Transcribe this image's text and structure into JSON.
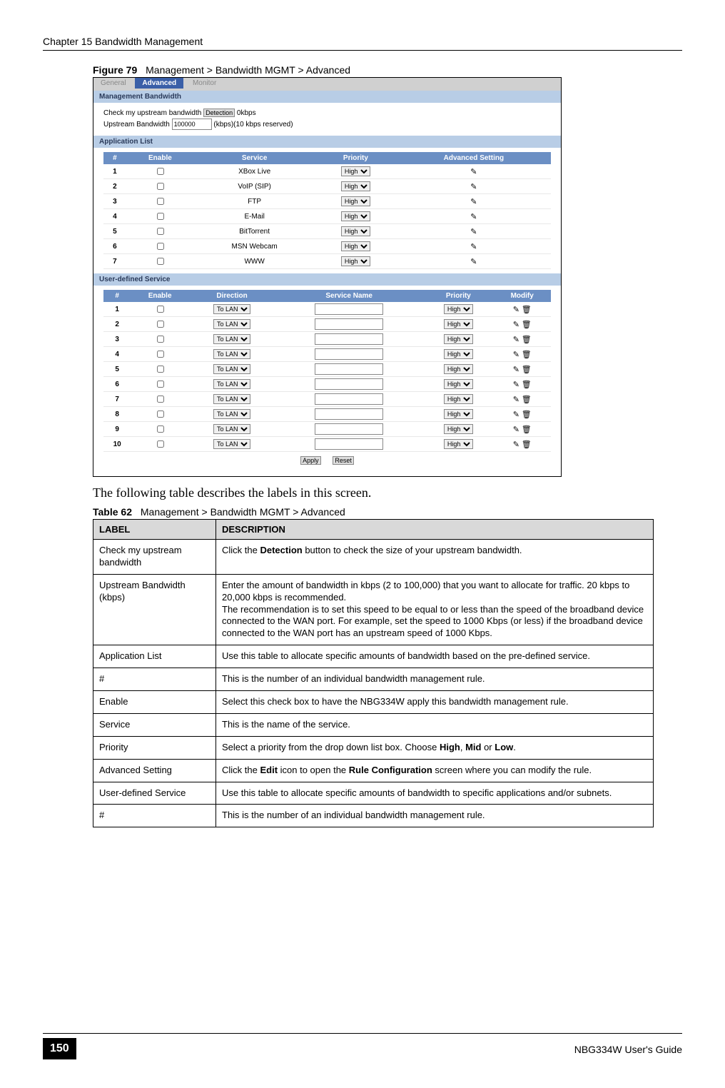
{
  "header": {
    "chapter": "Chapter 15 Bandwidth Management"
  },
  "figure": {
    "label": "Figure 79",
    "title": "Management > Bandwidth MGMT > Advanced"
  },
  "screenshot": {
    "tabs": [
      "General",
      "Advanced",
      "Monitor"
    ],
    "active_tab": "Advanced",
    "mgmt_bw_header": "Management Bandwidth",
    "check_label": "Check my upstream bandwidth",
    "detection_btn": "Detection",
    "check_suffix": "0kbps",
    "upstream_label": "Upstream Bandwidth",
    "upstream_value": "100000",
    "upstream_suffix": "(kbps)(10 kbps reserved)",
    "app_list_header": "Application List",
    "app_cols": [
      "#",
      "Enable",
      "Service",
      "Priority",
      "Advanced Setting"
    ],
    "app_rows": [
      {
        "n": "1",
        "svc": "XBox Live",
        "pri": "High"
      },
      {
        "n": "2",
        "svc": "VoIP (SIP)",
        "pri": "High"
      },
      {
        "n": "3",
        "svc": "FTP",
        "pri": "High"
      },
      {
        "n": "4",
        "svc": "E-Mail",
        "pri": "High"
      },
      {
        "n": "5",
        "svc": "BitTorrent",
        "pri": "High"
      },
      {
        "n": "6",
        "svc": "MSN Webcam",
        "pri": "High"
      },
      {
        "n": "7",
        "svc": "WWW",
        "pri": "High"
      }
    ],
    "uds_header": "User-defined Service",
    "uds_cols": [
      "#",
      "Enable",
      "Direction",
      "Service Name",
      "Priority",
      "Modify"
    ],
    "uds_rows": [
      {
        "n": "1",
        "dir": "To LAN",
        "pri": "High"
      },
      {
        "n": "2",
        "dir": "To LAN",
        "pri": "High"
      },
      {
        "n": "3",
        "dir": "To LAN",
        "pri": "High"
      },
      {
        "n": "4",
        "dir": "To LAN",
        "pri": "High"
      },
      {
        "n": "5",
        "dir": "To LAN",
        "pri": "High"
      },
      {
        "n": "6",
        "dir": "To LAN",
        "pri": "High"
      },
      {
        "n": "7",
        "dir": "To LAN",
        "pri": "High"
      },
      {
        "n": "8",
        "dir": "To LAN",
        "pri": "High"
      },
      {
        "n": "9",
        "dir": "To LAN",
        "pri": "High"
      },
      {
        "n": "10",
        "dir": "To LAN",
        "pri": "High"
      }
    ],
    "apply_btn": "Apply",
    "reset_btn": "Reset"
  },
  "intro_text": "The following table describes the labels in this screen.",
  "table": {
    "label": "Table 62",
    "title": "Management > Bandwidth MGMT > Advanced",
    "col_label": "LABEL",
    "col_desc": "DESCRIPTION",
    "rows": [
      {
        "label": "Check my upstream bandwidth",
        "desc": "Click the <b>Detection</b> button to check the size of your upstream bandwidth."
      },
      {
        "label": "Upstream Bandwidth (kbps)",
        "desc": "Enter the amount of bandwidth in kbps (2 to 100,000) that you want to allocate for traffic. 20 kbps to 20,000 kbps is recommended.<br>The recommendation is to set this speed to be equal to or less than the speed of the broadband device connected to the WAN port. For example, set the speed to 1000 Kbps (or less) if the broadband device connected to the WAN port has an upstream speed of 1000 Kbps."
      },
      {
        "label": "Application List",
        "desc": "Use this table to allocate specific amounts of bandwidth based on the pre-defined service."
      },
      {
        "label": "#",
        "desc": "This is the number of an individual bandwidth management rule."
      },
      {
        "label": "Enable",
        "desc": "Select this check box to have the NBG334W apply this bandwidth management rule."
      },
      {
        "label": "Service",
        "desc": "This is the name of the service."
      },
      {
        "label": "Priority",
        "desc": "Select a priority from the drop down list box. Choose <b>High</b>, <b>Mid</b> or <b>Low</b>."
      },
      {
        "label": "Advanced Setting",
        "desc": "Click the <b>Edit</b> icon to open the <b>Rule Configuration</b> screen where you can modify the rule."
      },
      {
        "label": "User-defined Service",
        "desc": "Use this table to allocate specific amounts of bandwidth to specific applications and/or subnets."
      },
      {
        "label": "#",
        "desc": "This is the number of an individual bandwidth management rule."
      }
    ]
  },
  "footer": {
    "page": "150",
    "guide": "NBG334W User's Guide"
  }
}
